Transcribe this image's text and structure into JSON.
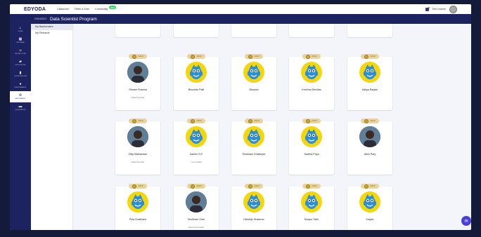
{
  "topnav": {
    "logo": "EDYODA",
    "links": [
      "Classroom",
      "Refer & Earn",
      "Community"
    ],
    "new_badge": "NEW",
    "user_name": "Test Learner"
  },
  "program": {
    "code": "DS040623",
    "title": "Data Scientist Program"
  },
  "sidebar_icons": [
    {
      "label": "HOME",
      "icon": "home-icon",
      "glyph": "⌂"
    },
    {
      "label": "PROGRAM",
      "icon": "building-icon",
      "glyph": "▦"
    },
    {
      "label": "INSTRUCTORS",
      "icon": "users-icon",
      "glyph": "☺"
    },
    {
      "label": "DISCUSSIONS",
      "icon": "chat-icon",
      "glyph": "▰"
    },
    {
      "label": "CERTIFICATIONS",
      "icon": "bookmark-icon",
      "glyph": "▮"
    },
    {
      "label": "PERFORMANCE",
      "icon": "gauge-icon",
      "glyph": "●"
    },
    {
      "label": "BATCHMATES",
      "icon": "group-icon",
      "glyph": "✣"
    },
    {
      "label": "PLACEMENTS",
      "icon": "briefcase-icon",
      "glyph": "▬"
    }
  ],
  "submenu": [
    "My Batchmates",
    "My Rewards"
  ],
  "badge_label": "GOLD",
  "cards": [
    {
      "name": "Shivam Sharma",
      "subtitle": "Data Scientist",
      "avatar": "photo"
    },
    {
      "name": "Bhushan Patil",
      "subtitle": "",
      "avatar": "mascot"
    },
    {
      "name": "Bhavani",
      "subtitle": "",
      "avatar": "mascot"
    },
    {
      "name": "Krushna Devidas",
      "subtitle": "",
      "avatar": "mascot"
    },
    {
      "name": "Aditya Ranjan",
      "subtitle": "",
      "avatar": "mascot"
    },
    {
      "name": "Dilip Markandan",
      "subtitle": "Data Scientist",
      "avatar": "photo"
    },
    {
      "name": "Sachin S R",
      "subtitle": "I Love Data",
      "avatar": "mascot"
    },
    {
      "name": "Shubham Chatterjee",
      "subtitle": "",
      "avatar": "mascot"
    },
    {
      "name": "Swetha Priya",
      "subtitle": "",
      "avatar": "mascot"
    },
    {
      "name": "Albin Pary",
      "subtitle": "",
      "avatar": "photo"
    },
    {
      "name": "Pula Gowthami",
      "subtitle": "",
      "avatar": "mascot"
    },
    {
      "name": "Shubham Gote",
      "subtitle": "Senior Associate",
      "avatar": "photo"
    },
    {
      "name": "Harshilp Ghaterao",
      "subtitle": "",
      "avatar": "mascot"
    },
    {
      "name": "Noopur Tarik",
      "subtitle": "",
      "avatar": "mascot"
    },
    {
      "name": "Kalyan",
      "subtitle": "",
      "avatar": "mascot"
    }
  ]
}
